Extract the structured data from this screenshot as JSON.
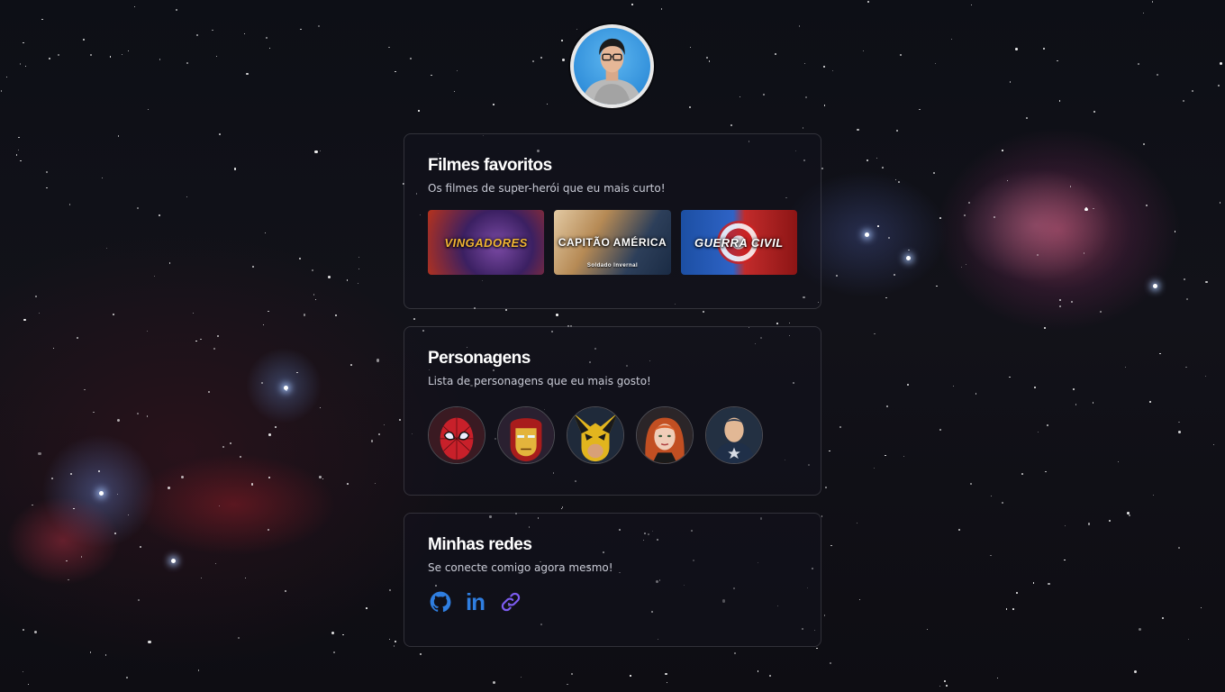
{
  "profile": {
    "avatar_icon": "profile-photo"
  },
  "movies_card": {
    "title": "Filmes favoritos",
    "subtitle": "Os filmes de super-herói que eu mais curto!",
    "items": [
      {
        "label": "Vingadores"
      },
      {
        "label": "Capitão América",
        "small": "Soldado Invernal"
      },
      {
        "label": "Guerra Civil"
      }
    ]
  },
  "characters_card": {
    "title": "Personagens",
    "subtitle": "Lista de personagens que eu mais gosto!",
    "items": [
      {
        "icon": "spider-man-avatar",
        "color": "#c8202a"
      },
      {
        "icon": "iron-man-avatar",
        "color": "#a81c1c"
      },
      {
        "icon": "wolverine-avatar",
        "color": "#e2b51e"
      },
      {
        "icon": "black-widow-avatar",
        "color": "#d8612e"
      },
      {
        "icon": "captain-america-avatar",
        "color": "#1f2f48"
      }
    ]
  },
  "socials_card": {
    "title": "Minhas redes",
    "subtitle": "Se conecte comigo agora mesmo!",
    "items": [
      {
        "icon": "github-icon",
        "color": "#2f7ee0"
      },
      {
        "icon": "linkedin-icon",
        "text": "in",
        "color": "#2f7ee0"
      },
      {
        "icon": "link-icon",
        "color": "#7c5cf0"
      }
    ]
  }
}
